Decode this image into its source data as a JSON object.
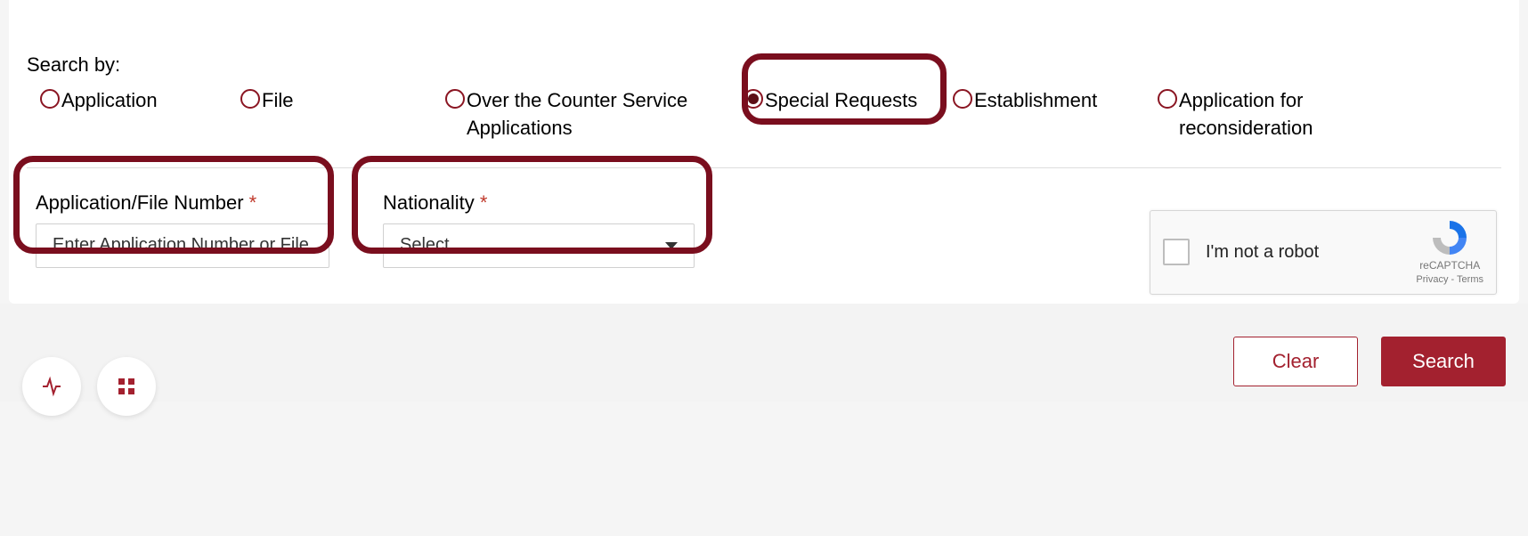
{
  "search": {
    "label": "Search by:",
    "options": {
      "application": "Application",
      "file": "File",
      "otc": "Over the Counter Service Applications",
      "special_requests": "Special Requests",
      "establishment": "Establishment",
      "reconsideration": "Application for reconsideration"
    },
    "selected": "special_requests"
  },
  "fields": {
    "app_number": {
      "label": "Application/File Number",
      "required": "*",
      "placeholder": "Enter Application Number or File",
      "value": ""
    },
    "nationality": {
      "label": "Nationality",
      "required": "*",
      "selected_text": "Select"
    }
  },
  "recaptcha": {
    "text": "I'm not a robot",
    "brand": "reCAPTCHA",
    "links": "Privacy - Terms"
  },
  "buttons": {
    "clear": "Clear",
    "search": "Search"
  }
}
